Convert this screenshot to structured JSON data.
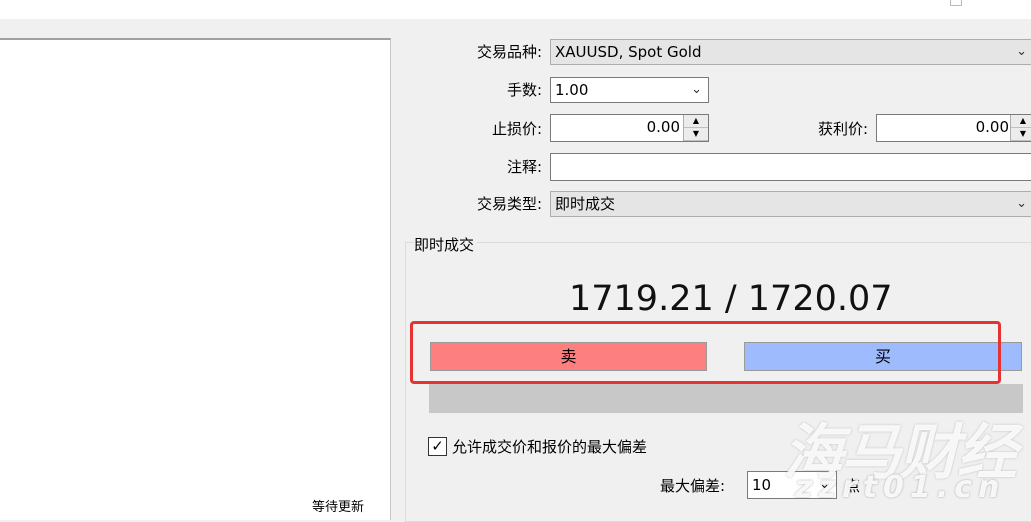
{
  "form": {
    "symbol_label": "交易品种:",
    "symbol_value": "XAUUSD, Spot Gold",
    "volume_label": "手数:",
    "volume_value": "1.00",
    "stoploss_label": "止损价:",
    "stoploss_value": "0.00",
    "takeprofit_label": "获利价:",
    "takeprofit_value": "0.00",
    "comment_label": "注释:",
    "comment_value": "",
    "type_label": "交易类型:",
    "type_value": "即时成交"
  },
  "execution": {
    "group_title": "即时成交",
    "price_quote": "1719.21 / 1720.07",
    "sell_label": "卖",
    "buy_label": "买",
    "allow_deviation_label": "允许成交价和报价的最大偏差",
    "allow_deviation_checked": true,
    "max_deviation_label": "最大偏差:",
    "max_deviation_value": "10",
    "points_label": "点"
  },
  "chart_panel": {
    "status": "等待更新"
  },
  "watermark": {
    "brand": "海马财经",
    "url": "zzrt01.cn"
  },
  "icons": {
    "dropdown": "chevron-down-icon",
    "spin_up": "arrow-up-icon",
    "spin_down": "arrow-down-icon",
    "check": "checkmark-icon"
  },
  "colors": {
    "sell": "#fe7f7f",
    "buy": "#9ebbfd",
    "highlight": "#e53232"
  }
}
